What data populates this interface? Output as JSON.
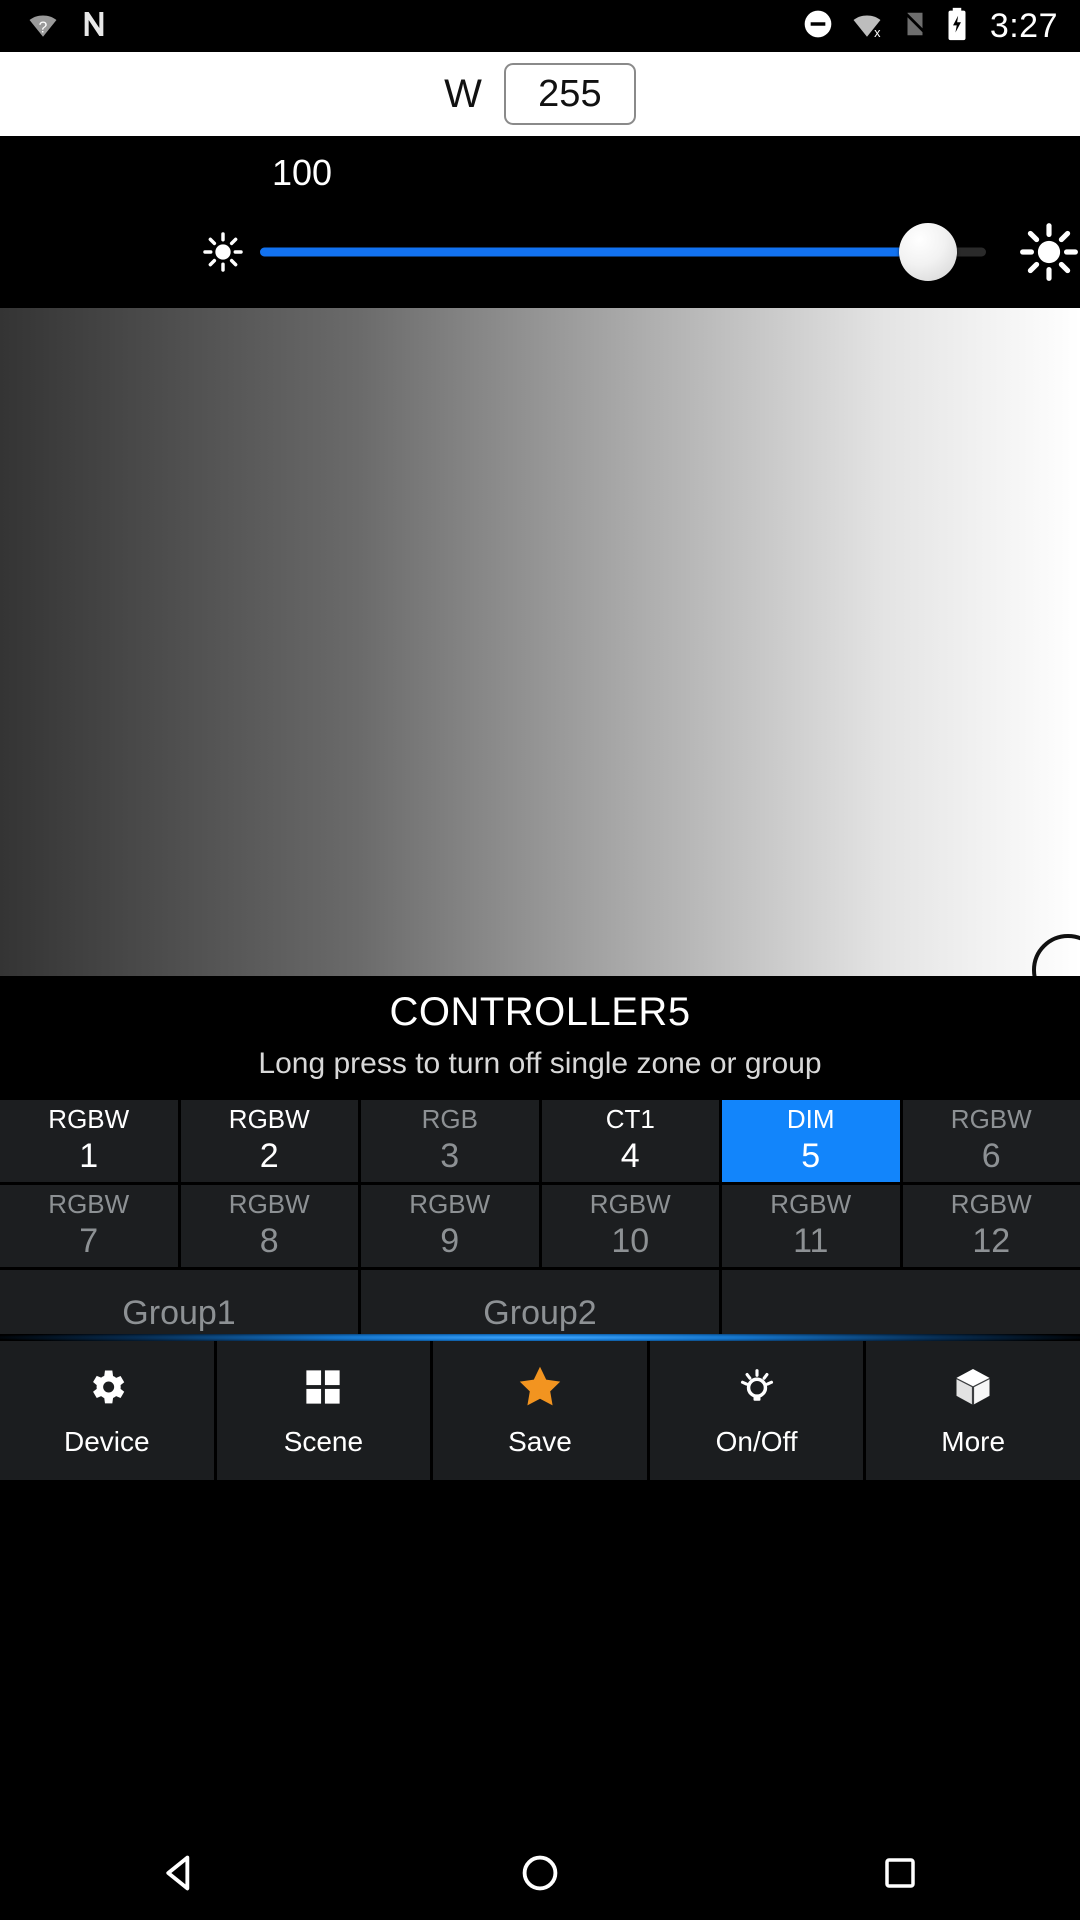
{
  "status_bar": {
    "time": "3:27",
    "left_icons": [
      "wifi-question-icon",
      "nfc-icon"
    ],
    "right_icons": [
      "do-not-disturb-icon",
      "wifi-off-icon",
      "vibrate-off-icon",
      "battery-charging-icon"
    ]
  },
  "white_channel": {
    "label": "W",
    "value": "255",
    "placeholder": "255"
  },
  "brightness": {
    "value": "100",
    "percent": 92,
    "min_icon": "brightness-low-icon",
    "max_icon": "brightness-high-icon",
    "accent_color": "#1272f0"
  },
  "picker": {
    "name": "white-gradient-picker",
    "from_color": "#343434",
    "to_color": "#ffffff",
    "handle": "picker-handle"
  },
  "controller": {
    "title": "CONTROLLER5",
    "subtitle": "Long press to turn off single zone or group",
    "selected_color": "#1285fb"
  },
  "zones": [
    {
      "type": "RGBW",
      "number": "1",
      "state": "active"
    },
    {
      "type": "RGBW",
      "number": "2",
      "state": "active"
    },
    {
      "type": "RGB",
      "number": "3",
      "state": "dim"
    },
    {
      "type": "CT1",
      "number": "4",
      "state": "active"
    },
    {
      "type": "DIM",
      "number": "5",
      "state": "selected"
    },
    {
      "type": "RGBW",
      "number": "6",
      "state": "dim"
    },
    {
      "type": "RGBW",
      "number": "7",
      "state": "dim"
    },
    {
      "type": "RGBW",
      "number": "8",
      "state": "dim"
    },
    {
      "type": "RGBW",
      "number": "9",
      "state": "dim"
    },
    {
      "type": "RGBW",
      "number": "10",
      "state": "dim"
    },
    {
      "type": "RGBW",
      "number": "11",
      "state": "dim"
    },
    {
      "type": "RGBW",
      "number": "12",
      "state": "dim"
    }
  ],
  "groups": [
    {
      "label": "Group1"
    },
    {
      "label": "Group2"
    },
    {
      "label": ""
    }
  ],
  "tabs": [
    {
      "label": "Device",
      "icon": "gear-icon"
    },
    {
      "label": "Scene",
      "icon": "grid-squares-icon"
    },
    {
      "label": "Save",
      "icon": "star-icon",
      "icon_color": "#f29420"
    },
    {
      "label": "On/Off",
      "icon": "lightbulb-icon"
    },
    {
      "label": "More",
      "icon": "cube-icon"
    }
  ],
  "nav_bar": {
    "back": "back-triangle-icon",
    "home": "home-circle-icon",
    "recents": "recents-square-icon"
  }
}
